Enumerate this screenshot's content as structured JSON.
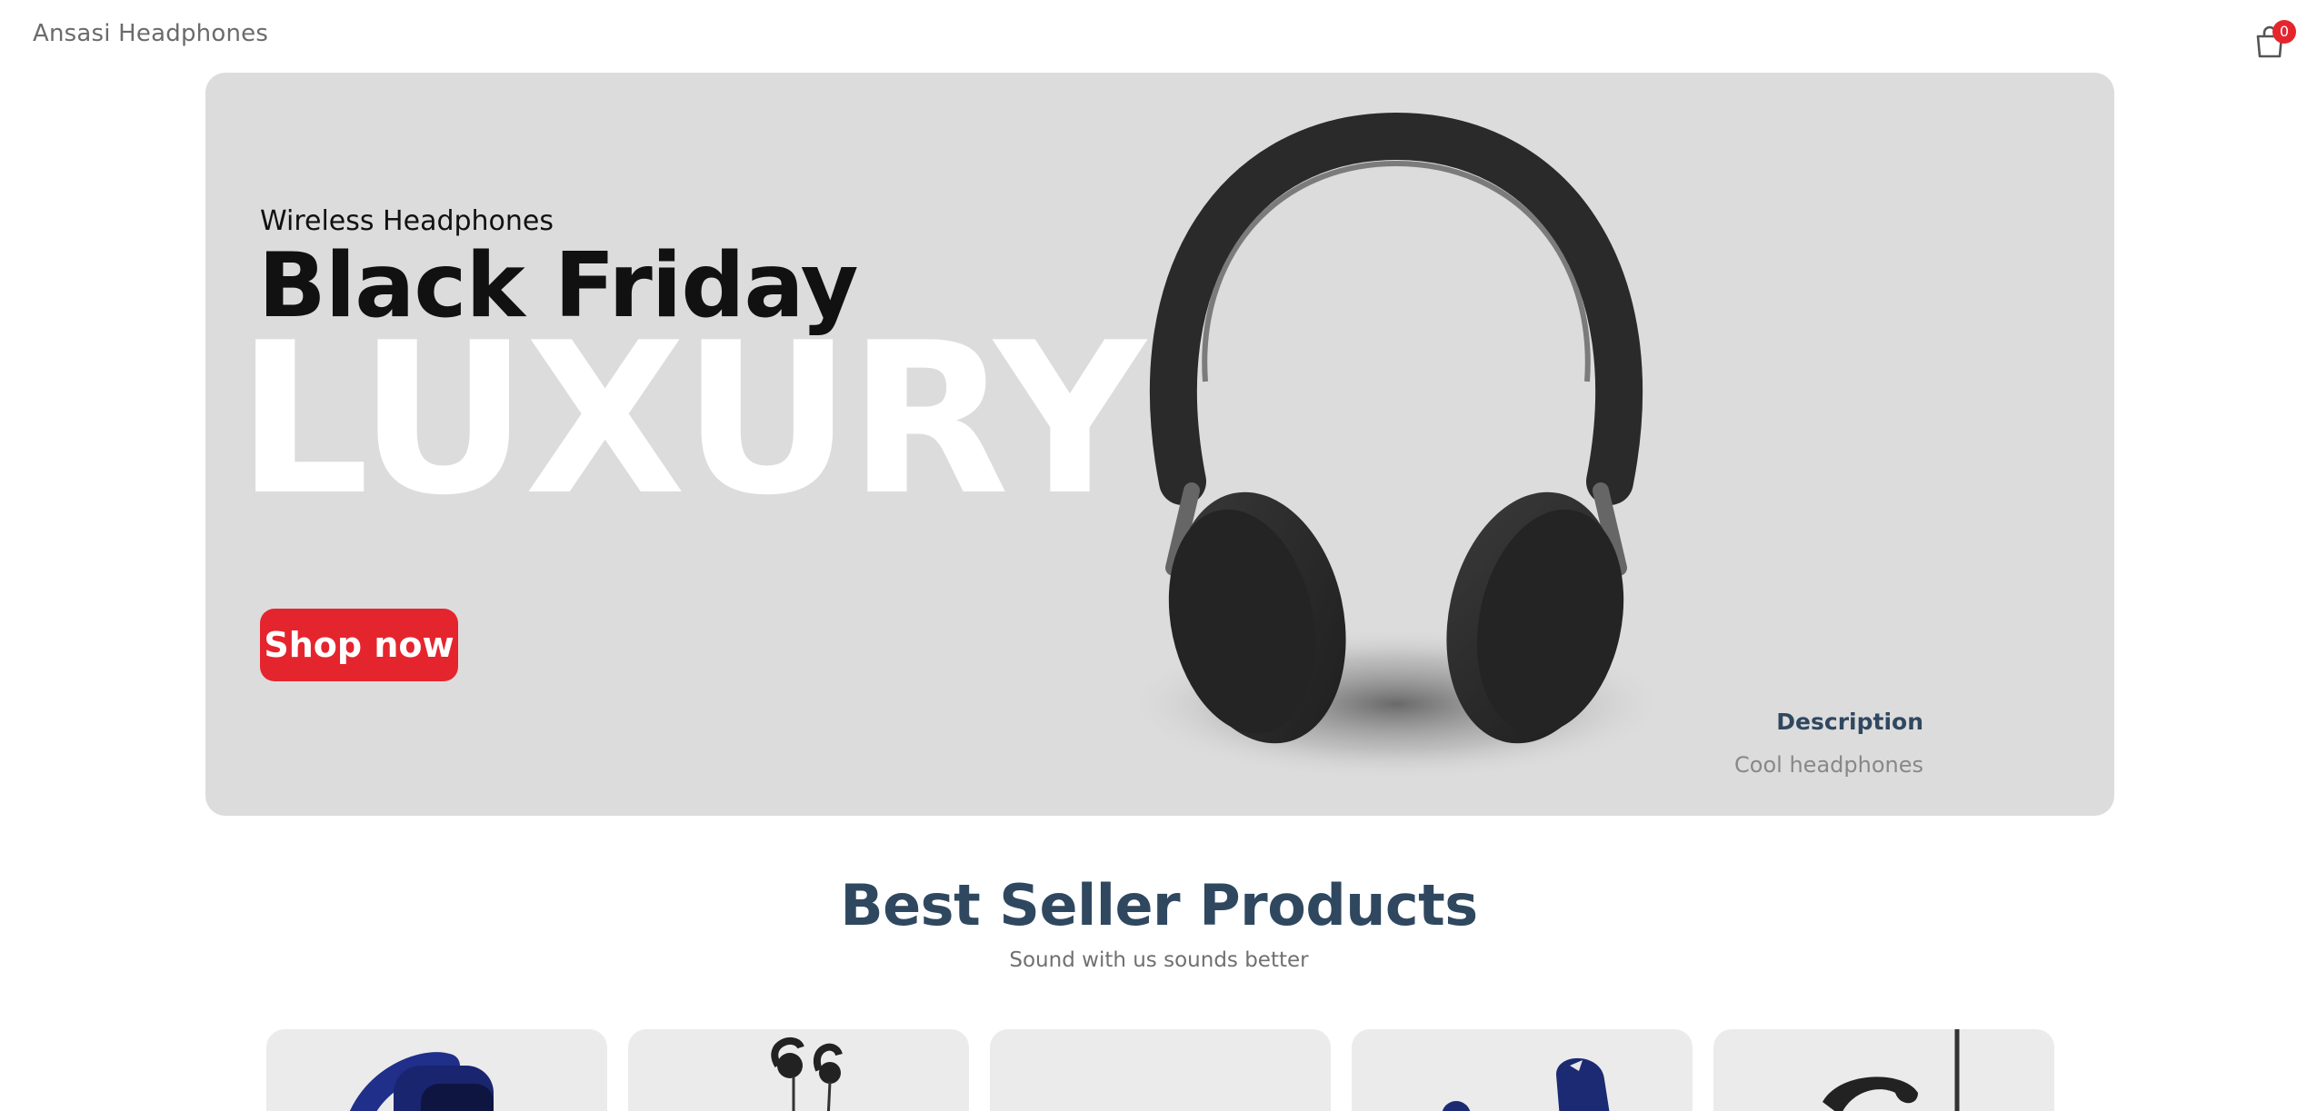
{
  "brand": {
    "name": "Ansasi Headphones"
  },
  "cart": {
    "count": "0",
    "icon": "shopping-bag-icon"
  },
  "hero": {
    "subtitle": "Wireless Headphones",
    "title": "Black Friday",
    "big_text": "LUXURY",
    "button_label": "Shop now",
    "description_title": "Description",
    "description_text": "Cool headphones",
    "image": "over-ear-headphones",
    "accent_color": "#e5252e",
    "background_color": "#dcdcdc"
  },
  "best_sellers": {
    "title": "Best Seller Products",
    "subtitle": "Sound with us sounds better",
    "title_color": "#2f4860",
    "products": [
      {
        "image": "blue-over-ear-headphones"
      },
      {
        "image": "black-earphones"
      },
      {
        "image": ""
      },
      {
        "image": "blue-true-wireless-earbuds"
      },
      {
        "image": "black-ear-hook-earphones"
      }
    ]
  }
}
